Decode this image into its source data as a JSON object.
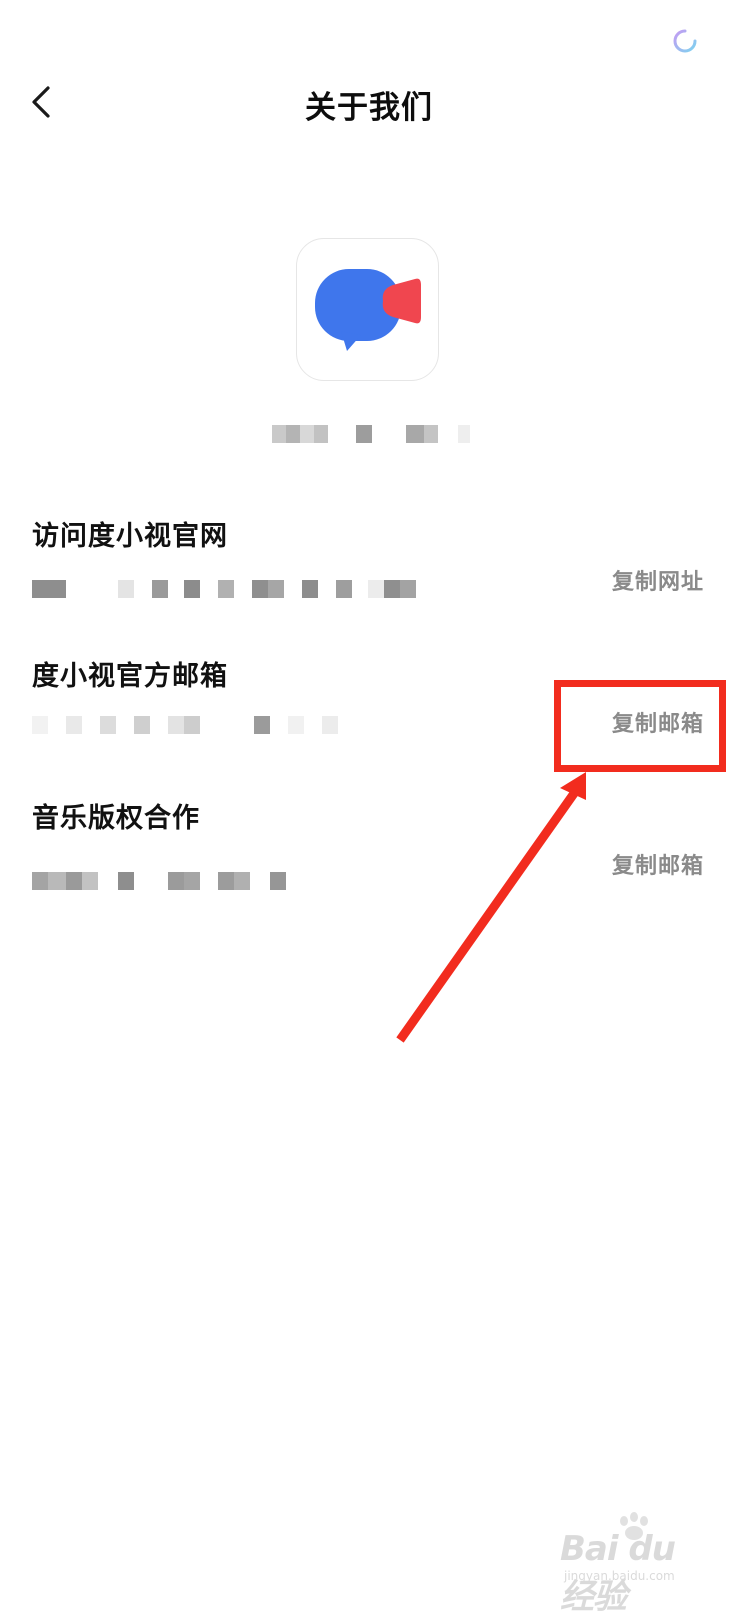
{
  "header": {
    "title": "关于我们",
    "back_icon": "chevron-left-icon"
  },
  "status": {
    "spinner_icon": "loading-spinner-icon"
  },
  "app": {
    "logo_icon": "video-chat-bubble-logo",
    "logo_colors": {
      "bubble": "#3f76ec",
      "triangle": "#f0464f"
    }
  },
  "rows": [
    {
      "title": "访问度小视官网",
      "action": "复制网址"
    },
    {
      "title": "度小视官方邮箱",
      "action": "复制邮箱"
    },
    {
      "title": "音乐版权合作",
      "action": "复制邮箱"
    }
  ],
  "annotation": {
    "color": "#f22c1e"
  },
  "watermark": {
    "brand": "Bai du 经验",
    "domain": "jingyan.baidu.com"
  }
}
